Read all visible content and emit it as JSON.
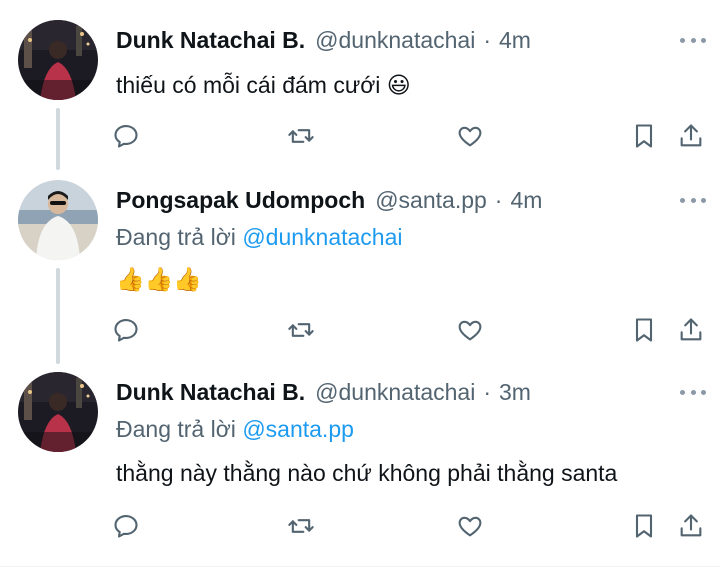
{
  "tweets": [
    {
      "name": "Dunk Natachai B.",
      "handle": "@dunknatachai",
      "dot": "·",
      "time": "4m",
      "replying_prefix": "",
      "replying_to": "",
      "text": "thiếu có mỗi cái đám cưới 😃"
    },
    {
      "name": "Pongsapak Udompoch",
      "handle": "@santa.pp",
      "dot": "·",
      "time": "4m",
      "replying_prefix": "Đang trả lời ",
      "replying_to": "@dunknatachai",
      "text": "👍👍👍"
    },
    {
      "name": "Dunk Natachai B.",
      "handle": "@dunknatachai",
      "dot": "·",
      "time": "3m",
      "replying_prefix": "Đang trả lời ",
      "replying_to": "@santa.pp",
      "text": "thằng này thằng nào chứ không phải thằng santa"
    }
  ],
  "icons": {
    "reply": "reply-icon",
    "retweet": "retweet-icon",
    "like": "heart-icon",
    "bookmark": "bookmark-icon",
    "share": "share-icon",
    "more": "more-dots-icon"
  },
  "colors": {
    "text": "#0f1419",
    "secondary": "#536471",
    "link": "#1d9bf0",
    "thread_line": "#cfd9de"
  }
}
